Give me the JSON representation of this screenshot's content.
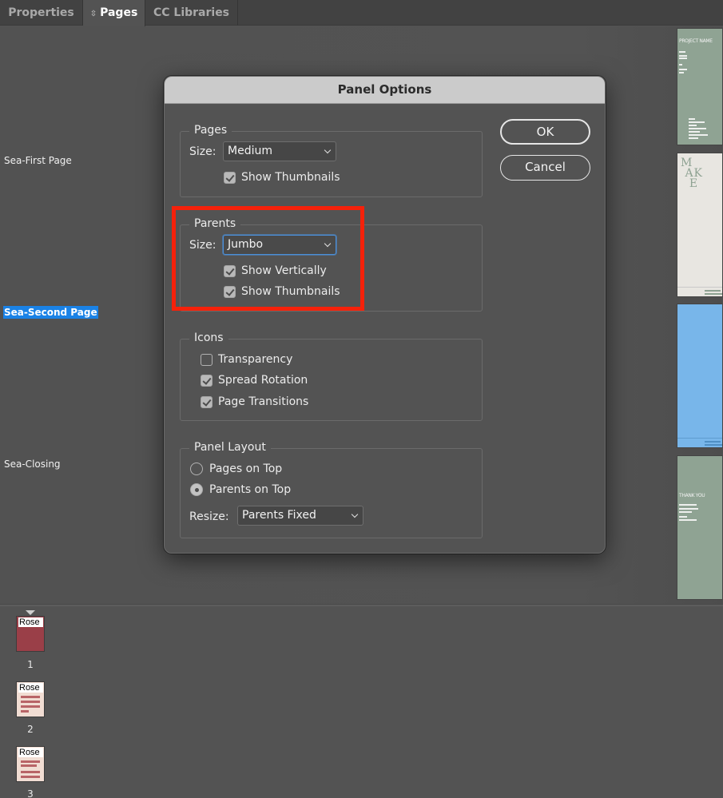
{
  "tabs": [
    {
      "label": "Properties",
      "active": false
    },
    {
      "label": "Pages",
      "active": true,
      "icon": "updown-arrows-icon"
    },
    {
      "label": "CC Libraries",
      "active": false
    }
  ],
  "parents": [
    {
      "name": "Sea-First Page",
      "selected": false,
      "thumb_color": "#8fa393",
      "thumb_text": "PROJECT NAME"
    },
    {
      "name": "Sea-Second Page",
      "selected": true,
      "thumb_color": "#e8e6e1",
      "thumb_text": "M\nAK\nE"
    },
    {
      "name": "Sea-Closing",
      "selected": false,
      "thumb_color": "#78b6ea",
      "thumb_text": ""
    },
    {
      "name": "",
      "selected": false,
      "thumb_color": "#8fa393",
      "thumb_text": "THANK YOU"
    }
  ],
  "pages": [
    {
      "number": "1",
      "parent_prefix": "Rose"
    },
    {
      "number": "2",
      "parent_prefix": "Rose"
    },
    {
      "number": "3",
      "parent_prefix": "Rose"
    }
  ],
  "dialog": {
    "title": "Panel Options",
    "ok_label": "OK",
    "cancel_label": "Cancel",
    "pages_group": {
      "title": "Pages",
      "size_label": "Size:",
      "size_value": "Medium",
      "show_thumbnails": {
        "label": "Show Thumbnails",
        "checked": true
      }
    },
    "parents_group": {
      "title": "Parents",
      "size_label": "Size:",
      "size_value": "Jumbo",
      "show_vertically": {
        "label": "Show Vertically",
        "checked": true
      },
      "show_thumbnails": {
        "label": "Show Thumbnails",
        "checked": true
      }
    },
    "icons_group": {
      "title": "Icons",
      "transparency": {
        "label": "Transparency",
        "checked": false
      },
      "spread_rotation": {
        "label": "Spread Rotation",
        "checked": true
      },
      "page_transitions": {
        "label": "Page Transitions",
        "checked": true
      }
    },
    "layout_group": {
      "title": "Panel Layout",
      "pages_on_top": {
        "label": "Pages on Top",
        "selected": false
      },
      "parents_on_top": {
        "label": "Parents on Top",
        "selected": true
      },
      "resize_label": "Resize:",
      "resize_value": "Parents Fixed"
    }
  },
  "annotation": {
    "color": "#f5210a",
    "target": "parents-group"
  }
}
